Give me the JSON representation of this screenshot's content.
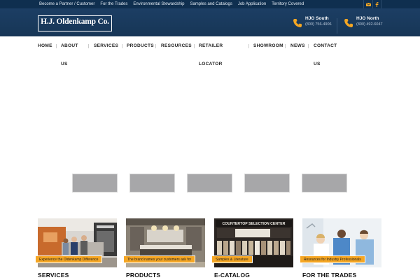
{
  "topbar": {
    "links": [
      "Become a Partner / Customer",
      "For the Trades",
      "Environmental Stewardship",
      "Samples and Catalogs",
      "Job Application",
      "Territory Covered"
    ],
    "social_icons": [
      "email-icon",
      "facebook-icon"
    ]
  },
  "header": {
    "logo": "H.J. Oldenkamp Co.",
    "locations": [
      {
        "title": "HJO South",
        "phone": "(800) 756-4906",
        "icon": "phone-icon"
      },
      {
        "title": "HJO North",
        "phone": "(800) 492-6047",
        "icon": "phone-icon"
      }
    ]
  },
  "nav": {
    "home": "HOME",
    "about_1": "ABOUT",
    "about_2": "US",
    "services": "SERVICES",
    "products": "PRODUCTS",
    "resources": "RESOURCES",
    "retailer_1": "RETAILER",
    "retailer_2": "LOCATOR",
    "showroom": "SHOWROOM",
    "news": "NEWS",
    "contact_1": "CONTACT",
    "contact_2": "US"
  },
  "cards": [
    {
      "tag": "Experience the Oldenkamp Difference",
      "heading": "SERVICES"
    },
    {
      "tag": "The brand names your customers ask for",
      "heading": "PRODUCTS"
    },
    {
      "tag": "Samples & Literature",
      "heading": "E-CATALOG",
      "sign": "COUNTERTOP SELECTION CENTER"
    },
    {
      "tag": "Resources for Industry Professionals",
      "heading": "FOR THE TRADES"
    }
  ],
  "colors": {
    "topbar": "#0f2f4f",
    "header": "#1b3c61",
    "accent": "#f5a623"
  }
}
